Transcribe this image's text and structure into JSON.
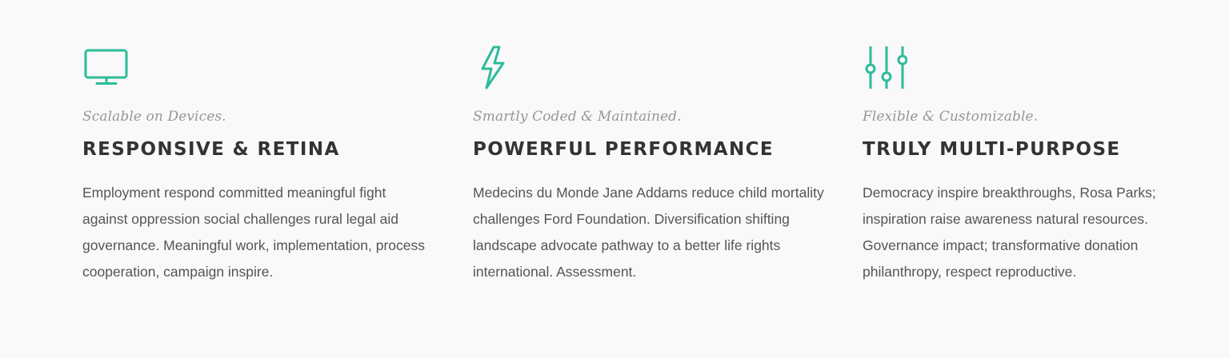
{
  "accent_color": "#2bbc9b",
  "features": [
    {
      "icon": "monitor-icon",
      "subtitle": "Scalable on Devices.",
      "title": "RESPONSIVE & RETINA",
      "description": "Employment respond committed meaningful fight against oppression social challenges rural legal aid governance. Meaningful work, implementation, process cooperation, campaign inspire."
    },
    {
      "icon": "lightning-bolt-icon",
      "subtitle": "Smartly Coded & Maintained.",
      "title": "POWERFUL PERFORMANCE",
      "description": "Medecins du Monde Jane Addams reduce child mortality challenges Ford Foundation. Diversification shifting landscape advocate pathway to a better life rights international. Assessment."
    },
    {
      "icon": "sliders-icon",
      "subtitle": "Flexible & Customizable.",
      "title": "TRULY MULTI-PURPOSE",
      "description": "Democracy inspire breakthroughs, Rosa Parks; inspiration raise awareness natural resources. Governance impact; transformative donation philanthropy, respect reproductive."
    }
  ]
}
